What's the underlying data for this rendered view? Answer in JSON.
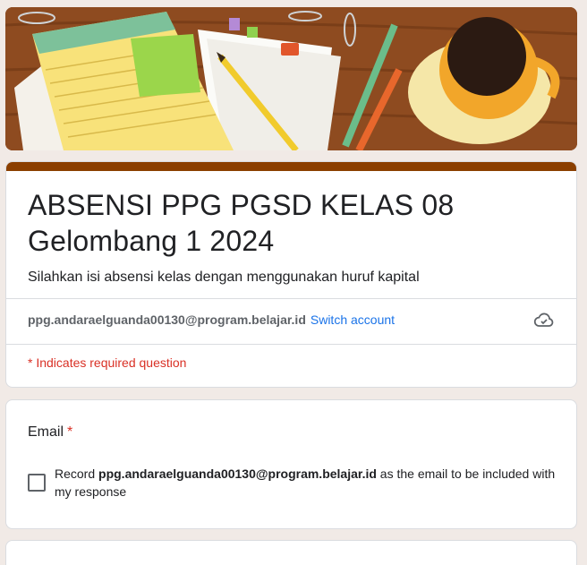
{
  "banner": {
    "description_icon": "desk-with-notepad-pencil-coffee-illustration"
  },
  "form": {
    "title": "ABSENSI PPG PGSD KELAS 08 Gelombang 1 2024",
    "description": "Silahkan isi absensi kelas dengan menggunakan huruf kapital",
    "accent_color": "#8b3f00"
  },
  "account": {
    "email": "ppg.andaraelguanda00130@program.belajar.id",
    "switch_label": "Switch account",
    "cloud_icon": "cloud-sync-icon"
  },
  "required_note": "* Indicates required question",
  "question_email": {
    "title": "Email",
    "required_mark": "*",
    "record_prefix": "Record",
    "record_email": "ppg.andaraelguanda00130@program.belajar.id",
    "record_suffix": "as the email to be included with my response",
    "checked": false
  },
  "colors": {
    "background": "#f1eae6",
    "link": "#1a73e8",
    "required": "#d93025"
  }
}
